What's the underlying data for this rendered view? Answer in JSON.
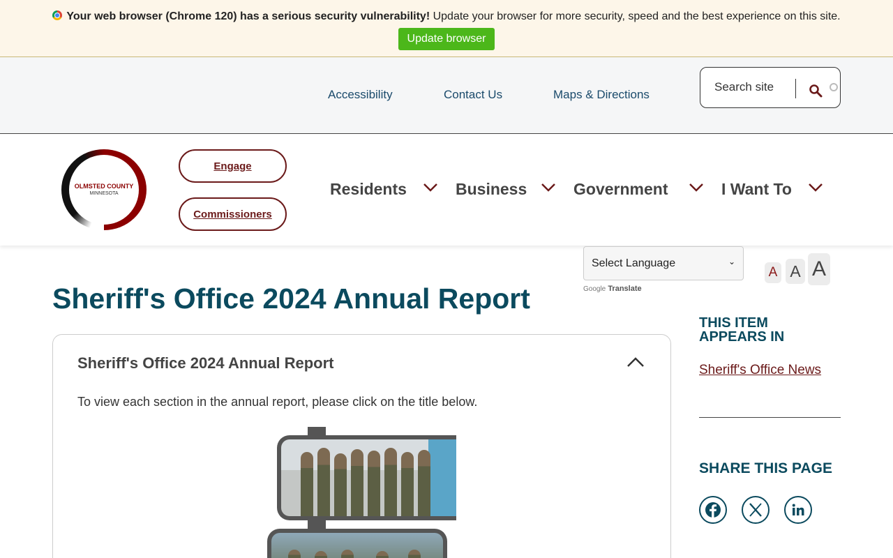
{
  "banner": {
    "bold_text": "Your web browser (Chrome 120) has a serious security vulnerability!",
    "text": " Update your browser for more security, speed and the best experience on this site.",
    "button": "Update browser"
  },
  "utility": {
    "links": [
      "Accessibility",
      "Contact Us",
      "Maps & Directions"
    ],
    "search_placeholder": "Search site"
  },
  "logo": {
    "line1": "OLMSTED COUNTY",
    "line2": "MINNESOTA"
  },
  "header": {
    "pills": [
      "Engage",
      "Commissioners"
    ],
    "nav": [
      "Residents",
      "Business",
      "Government",
      "I Want To"
    ]
  },
  "translate": {
    "select_label": "Select Language",
    "powered_google": "Google",
    "powered_translate": "Translate"
  },
  "font_sizes": [
    "A",
    "A",
    "A"
  ],
  "page": {
    "title": "Sheriff's Office 2024 Annual Report",
    "accordion_title": "Sheriff's Office 2024 Annual Report",
    "accordion_text": "To view each section in the annual report, please click on the title below."
  },
  "sidebar": {
    "appears_heading": "THIS ITEM APPEARS IN",
    "appears_link": "Sheriff's Office News",
    "share_heading": "SHARE THIS PAGE",
    "social": [
      "facebook-icon",
      "x-icon",
      "linkedin-icon"
    ]
  },
  "colors": {
    "accent": "#0b4a5e",
    "brand_red": "#6b1a1a",
    "update_green": "#4cb71a"
  }
}
